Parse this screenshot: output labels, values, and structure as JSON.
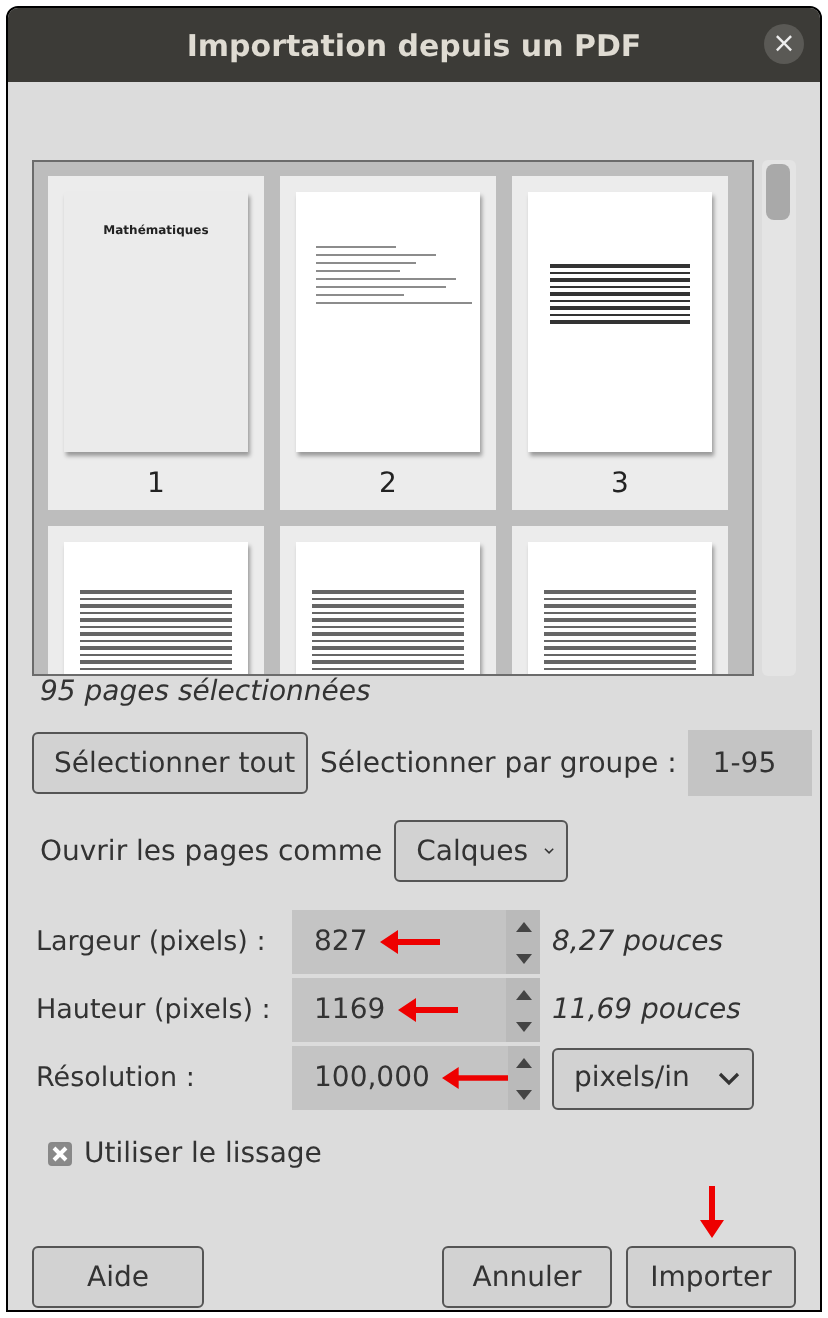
{
  "window": {
    "title": "Importation depuis un PDF",
    "close": "×"
  },
  "pages": [
    {
      "label": "1",
      "kind": "cover",
      "title": "Mathématiques"
    },
    {
      "label": "2",
      "kind": "list"
    },
    {
      "label": "3",
      "kind": "contents"
    },
    {
      "kind": "text"
    },
    {
      "kind": "text"
    },
    {
      "kind": "text"
    }
  ],
  "selection_count": "95 pages sélectionnées",
  "select_all_button": "Sélectionner tout",
  "range": {
    "label": "Sélectionner par groupe :",
    "value": "1-95"
  },
  "open_as": {
    "label": "Ouvrir les pages comme",
    "value": "Calques"
  },
  "fields": [
    {
      "label": "Largeur (pixels) :",
      "value": "827",
      "note": "8,27 pouces"
    },
    {
      "label": "Hauteur (pixels) :",
      "value": "1169",
      "note": "11,69 pouces"
    },
    {
      "label": "Résolution :",
      "value": "100,000",
      "unit": "pixels/in"
    }
  ],
  "antialiasing": {
    "label": "Utiliser le lissage",
    "checked": true
  },
  "buttons": [
    {
      "label": "Aide",
      "kind": "help"
    },
    {
      "label": "Annuler",
      "kind": "cancel"
    },
    {
      "label": "Importer",
      "kind": "import",
      "marked": true
    }
  ]
}
